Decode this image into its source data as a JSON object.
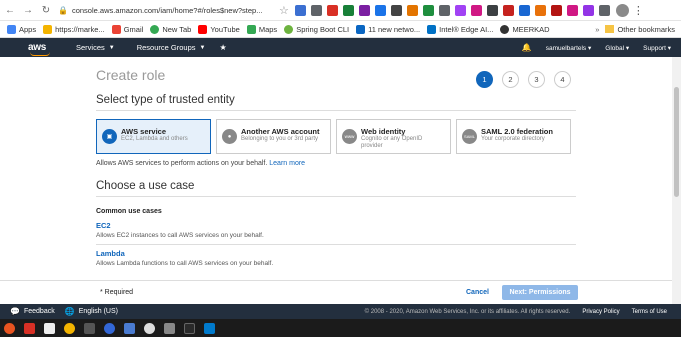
{
  "browser": {
    "url": "console.aws.amazon.com/iam/home?#/roles$new?step...",
    "bookmarks": [
      "Apps",
      "https://marke...",
      "Gmail",
      "New Tab",
      "YouTube",
      "Maps",
      "Spring Boot CLI",
      "11 new netwo...",
      "Intel® Edge AI...",
      "MEERKAD"
    ],
    "other_bookmarks": "Other bookmarks"
  },
  "nav": {
    "logo": "aws",
    "services": "Services",
    "resource_groups": "Resource Groups",
    "user": "samuelbartels",
    "region": "Global",
    "support": "Support"
  },
  "page": {
    "title": "Create role",
    "steps": [
      "1",
      "2",
      "3",
      "4"
    ],
    "section_trusted": "Select type of trusted entity",
    "tiles": [
      {
        "title": "AWS service",
        "sub": "EC2, Lambda and others",
        "icon": "cube-icon"
      },
      {
        "title": "Another AWS account",
        "sub": "Belonging to you or 3rd party",
        "icon": "user-icon"
      },
      {
        "title": "Web identity",
        "sub": "Cognito or any OpenID provider",
        "icon": "www-icon"
      },
      {
        "title": "SAML 2.0 federation",
        "sub": "Your corporate directory",
        "icon": "saml-icon"
      }
    ],
    "tile_icon_text": [
      "▣",
      "●",
      "www",
      "SAML"
    ],
    "helper_text": "Allows AWS services to perform actions on your behalf.",
    "learn_more": "Learn more",
    "section_usecase": "Choose a use case",
    "common_label": "Common use cases",
    "use_cases": [
      {
        "name": "EC2",
        "desc": "Allows EC2 instances to call AWS services on your behalf."
      },
      {
        "name": "Lambda",
        "desc": "Allows Lambda functions to call AWS services on your behalf."
      }
    ]
  },
  "actions": {
    "required": "* Required",
    "cancel": "Cancel",
    "next": "Next: Permissions"
  },
  "footer": {
    "feedback": "Feedback",
    "language": "English (US)",
    "copyright": "© 2008 - 2020, Amazon Web Services, Inc. or its affiliates. All rights reserved.",
    "privacy": "Privacy Policy",
    "terms": "Terms of Use"
  }
}
